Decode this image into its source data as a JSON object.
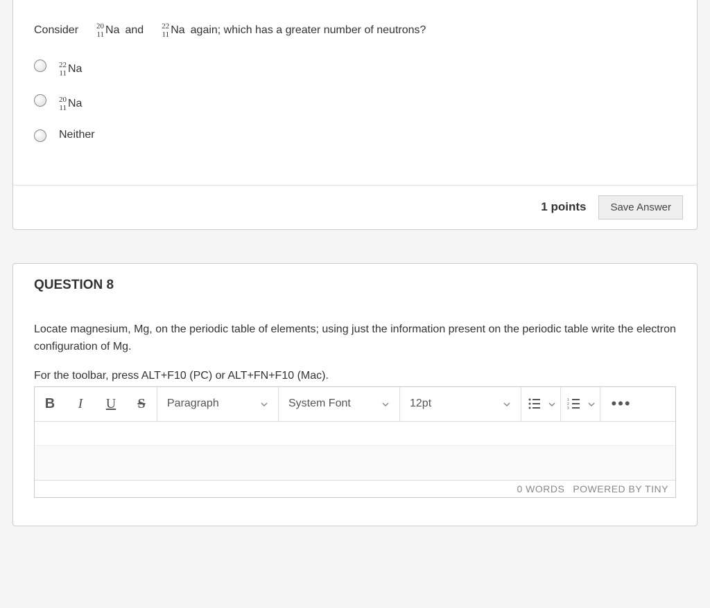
{
  "q7": {
    "prefix": "Consider",
    "iso1": {
      "mass": "20",
      "atomic": "11",
      "sym": "Na"
    },
    "mid": " and",
    "iso2": {
      "mass": "22",
      "atomic": "11",
      "sym": "Na"
    },
    "suffix": " again; which has a greater number of neutrons?",
    "opts": {
      "a": {
        "mass": "22",
        "atomic": "11",
        "sym": "Na"
      },
      "b": {
        "mass": "20",
        "atomic": "11",
        "sym": "Na"
      },
      "c_label": "Neither"
    },
    "points": "1 points",
    "save": "Save Answer"
  },
  "q8": {
    "title": "QUESTION 8",
    "prompt": "Locate magnesium, Mg, on the periodic table of elements; using just the information present on the periodic table write the electron configuration of Mg.",
    "toolbar_hint": "For the toolbar, press ALT+F10 (PC) or ALT+FN+F10 (Mac).",
    "tb": {
      "bold": "B",
      "italic": "I",
      "underline": "U",
      "strike": "S",
      "block": "Paragraph",
      "font": "System Font",
      "size": "12pt",
      "more": "•••"
    },
    "status": {
      "words": "0 WORDS",
      "powered": "POWERED BY TINY"
    }
  }
}
